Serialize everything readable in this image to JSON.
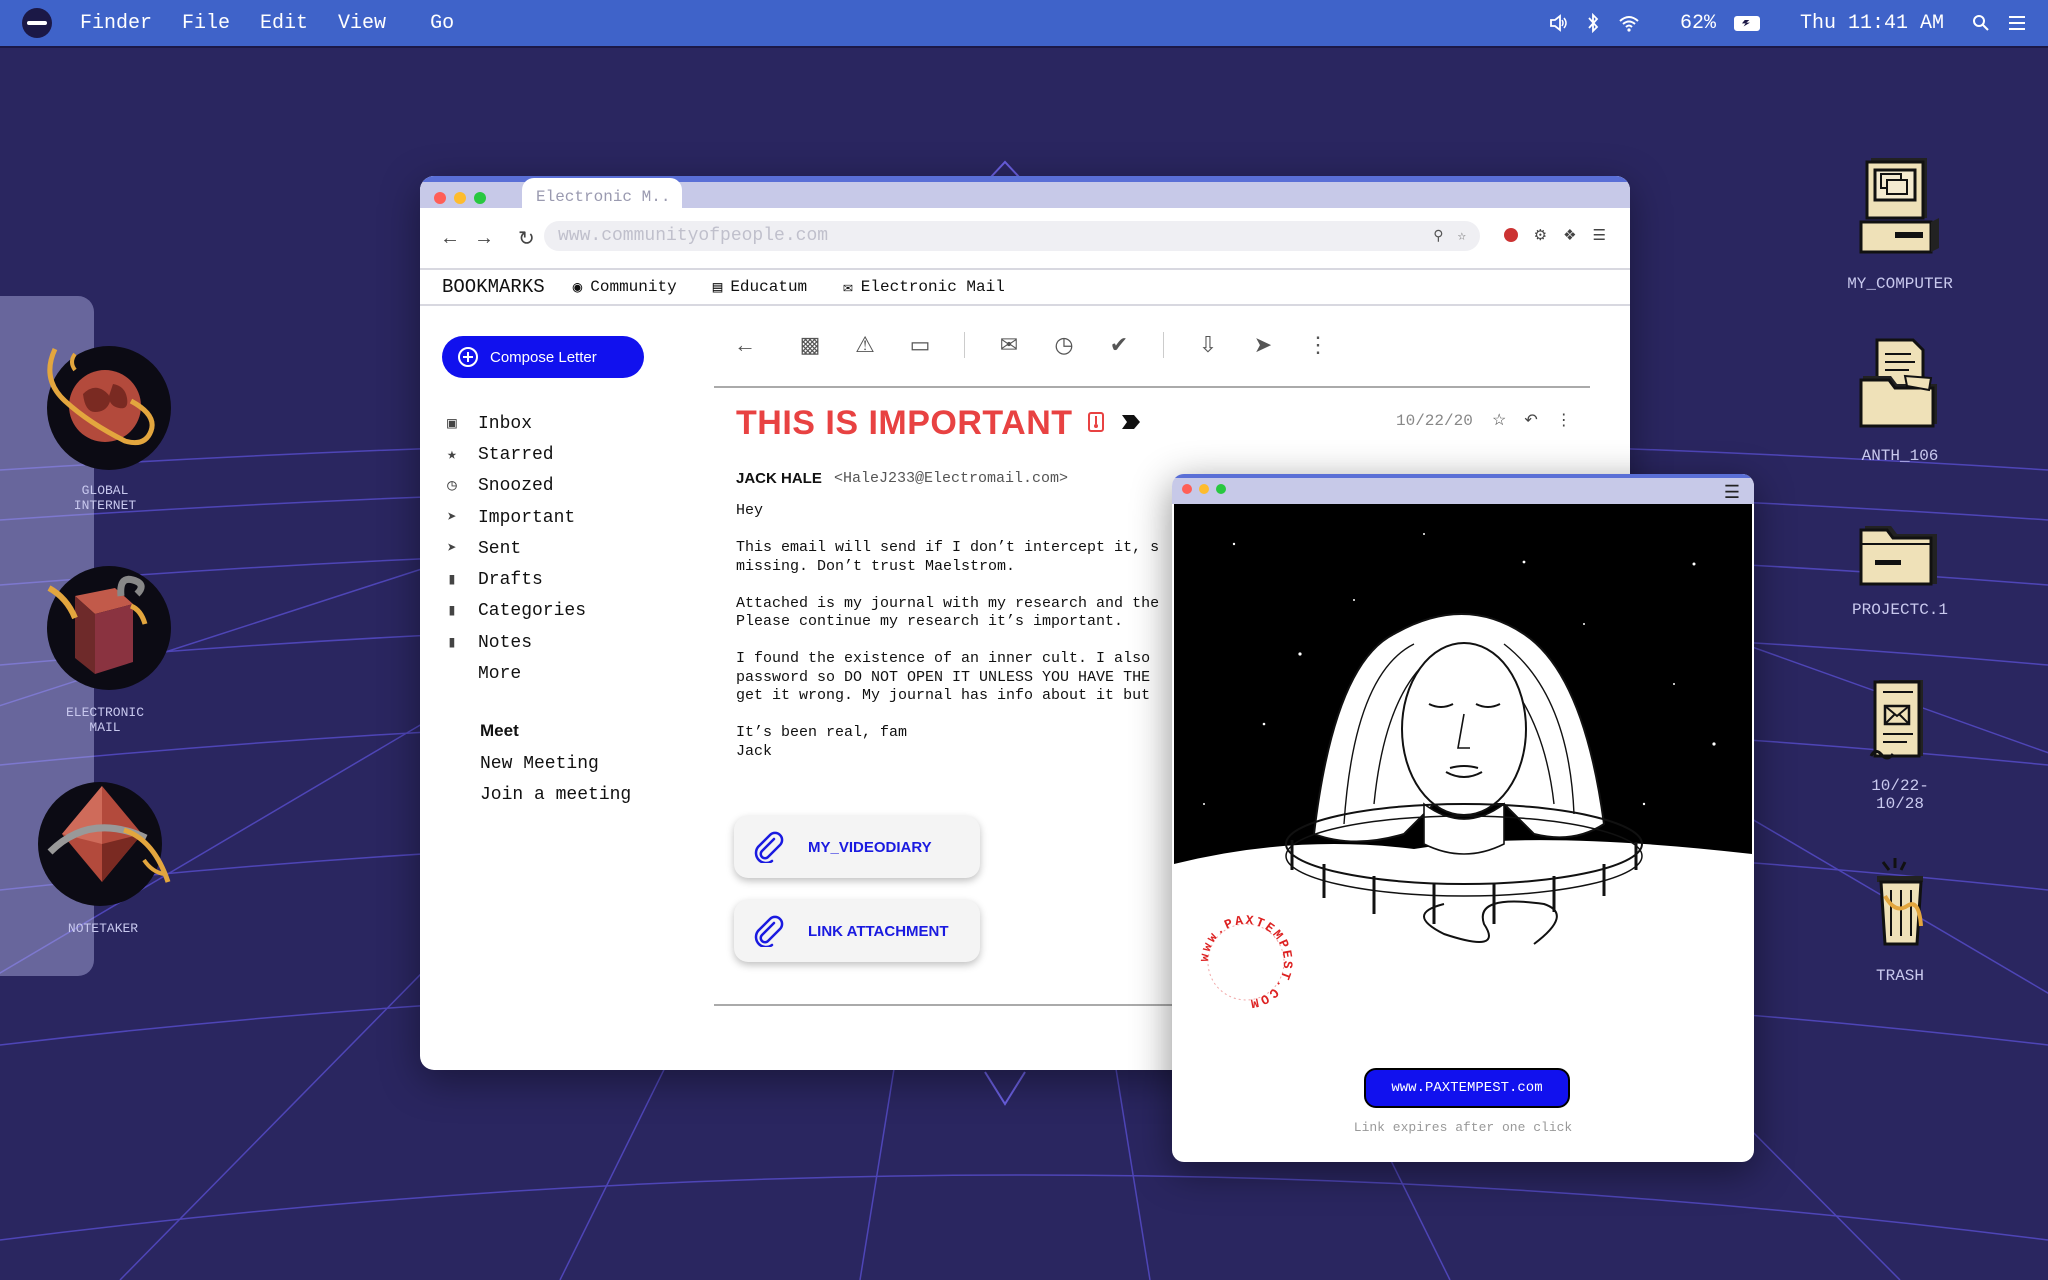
{
  "menubar": {
    "menus": [
      "Finder",
      "File",
      "Edit",
      "View",
      "Go"
    ],
    "battery": "62%",
    "clock": "Thu 11:41 AM"
  },
  "dock": {
    "items": [
      {
        "label": "GLOBAL\nINTERNET",
        "icon": "globe-icon"
      },
      {
        "label": "ELECTRONIC\nMAIL",
        "icon": "mailbox-icon"
      },
      {
        "label": "NOTETAKER",
        "icon": "crystal-icon"
      }
    ]
  },
  "desktop": {
    "items": [
      {
        "label": "MY_COMPUTER",
        "icon": "computer-icon"
      },
      {
        "label": "ANTH_106",
        "icon": "folder-docs-icon"
      },
      {
        "label": "PROJECTC.1",
        "icon": "folder-icon"
      },
      {
        "label": "10/22-\n10/28",
        "icon": "scroll-icon"
      },
      {
        "label": "TRASH",
        "icon": "trash-icon"
      }
    ]
  },
  "browser": {
    "tab_title": "Electronic M..",
    "url": "www.communityofpeople.com",
    "bookmarks_title": "BOOKMARKS",
    "bookmarks": [
      "Community",
      "Educatum",
      "Electronic Mail"
    ]
  },
  "mail": {
    "compose_label": "Compose Letter",
    "folders": [
      "Inbox",
      "Starred",
      "Snoozed",
      "Important",
      "Sent",
      "Drafts",
      "Categories",
      "Notes",
      "More"
    ],
    "meet_heading": "Meet",
    "meet_items": [
      "New Meeting",
      "Join a meeting"
    ],
    "subject": "THIS IS IMPORTANT",
    "date": "10/22/20",
    "sender_name": "JACK HALE",
    "sender_email": "<HaleJ233@Electromail.com>",
    "body": "Hey\n\nThis email will send if I don’t intercept it, s\nmissing. Don’t trust Maelstrom.\n\nAttached is my journal with my research and the\nPlease continue my research it’s important.\n\nI found the existence of an inner cult. I also\npassword so DO NOT OPEN IT UNLESS YOU HAVE THE\nget it wrong. My journal has info about it but\n\nIt’s been real, fam\nJack",
    "attachments": [
      "MY_VIDEODIARY",
      "LINK ATTACHMENT"
    ]
  },
  "popup": {
    "stamp_text": "www.PAXTEMPEST.COM",
    "link_button": "www.PAXTEMPEST.com",
    "note": "Link expires after one click"
  },
  "colors": {
    "desktop_bg": "#2a2660",
    "grid": "#5a4fd0",
    "menubar": "#3f63c9",
    "accent_blue": "#1111ee",
    "subject_red": "#e84242"
  }
}
